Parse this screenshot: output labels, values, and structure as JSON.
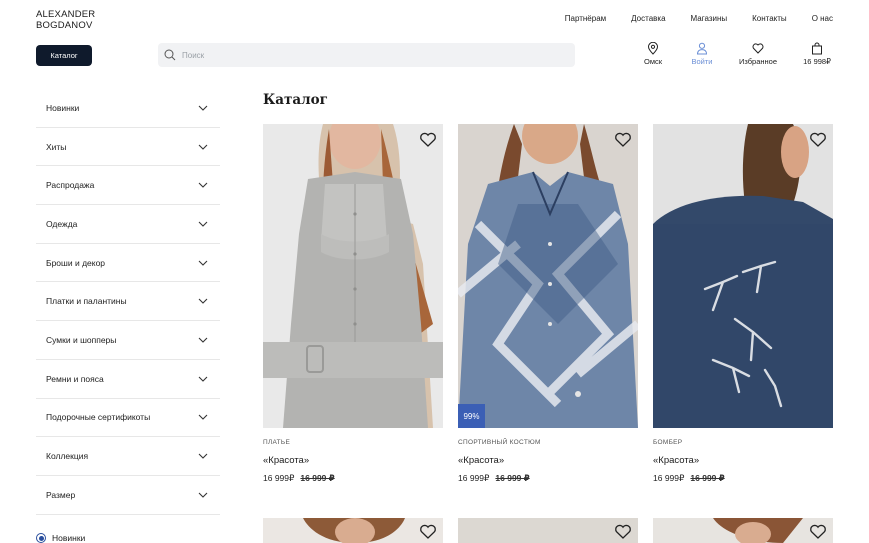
{
  "brand": {
    "line1": "ALEXANDER",
    "line2": "BOGDANOV"
  },
  "topnav": [
    "Партнёрам",
    "Доставка",
    "Магазины",
    "Контакты",
    "О нас"
  ],
  "catalog_button": "Каталог",
  "search": {
    "placeholder": "Поиск"
  },
  "header_icons": {
    "location": {
      "label": "Омск",
      "icon": "location-pin-icon"
    },
    "login": {
      "label": "Войти",
      "icon": "user-icon"
    },
    "favorites": {
      "label": "Избранное",
      "icon": "heart-icon"
    },
    "cart": {
      "label": "16 998₽",
      "icon": "bag-icon"
    }
  },
  "sidebar": {
    "items": [
      "Новинки",
      "Хиты",
      "Распродажа",
      "Одежда",
      "Броши и декор",
      "Платки и палантины",
      "Сумки и шопперы",
      "Ремни и пояса",
      "Подорочные сертификоты",
      "Коллекция",
      "Размер"
    ],
    "radio_label": "Новинки"
  },
  "page_title": "Каталог",
  "products": [
    {
      "category": "ПЛАТЬЕ",
      "name": "«Красота»",
      "price": "16 999₽",
      "old_price": "16 999 ₽",
      "badge": ""
    },
    {
      "category": "СПОРТИВНЫЙ КОСТЮМ",
      "name": "«Красота»",
      "price": "16 999₽",
      "old_price": "16 999 ₽",
      "badge": "99%"
    },
    {
      "category": "БОМБЕР",
      "name": "«Красота»",
      "price": "16 999₽",
      "old_price": "16 999 ₽",
      "badge": ""
    }
  ],
  "colors": {
    "accent": "#0f1a2c",
    "badge": "#3b5fb5",
    "link_active": "#6b8fd6"
  }
}
